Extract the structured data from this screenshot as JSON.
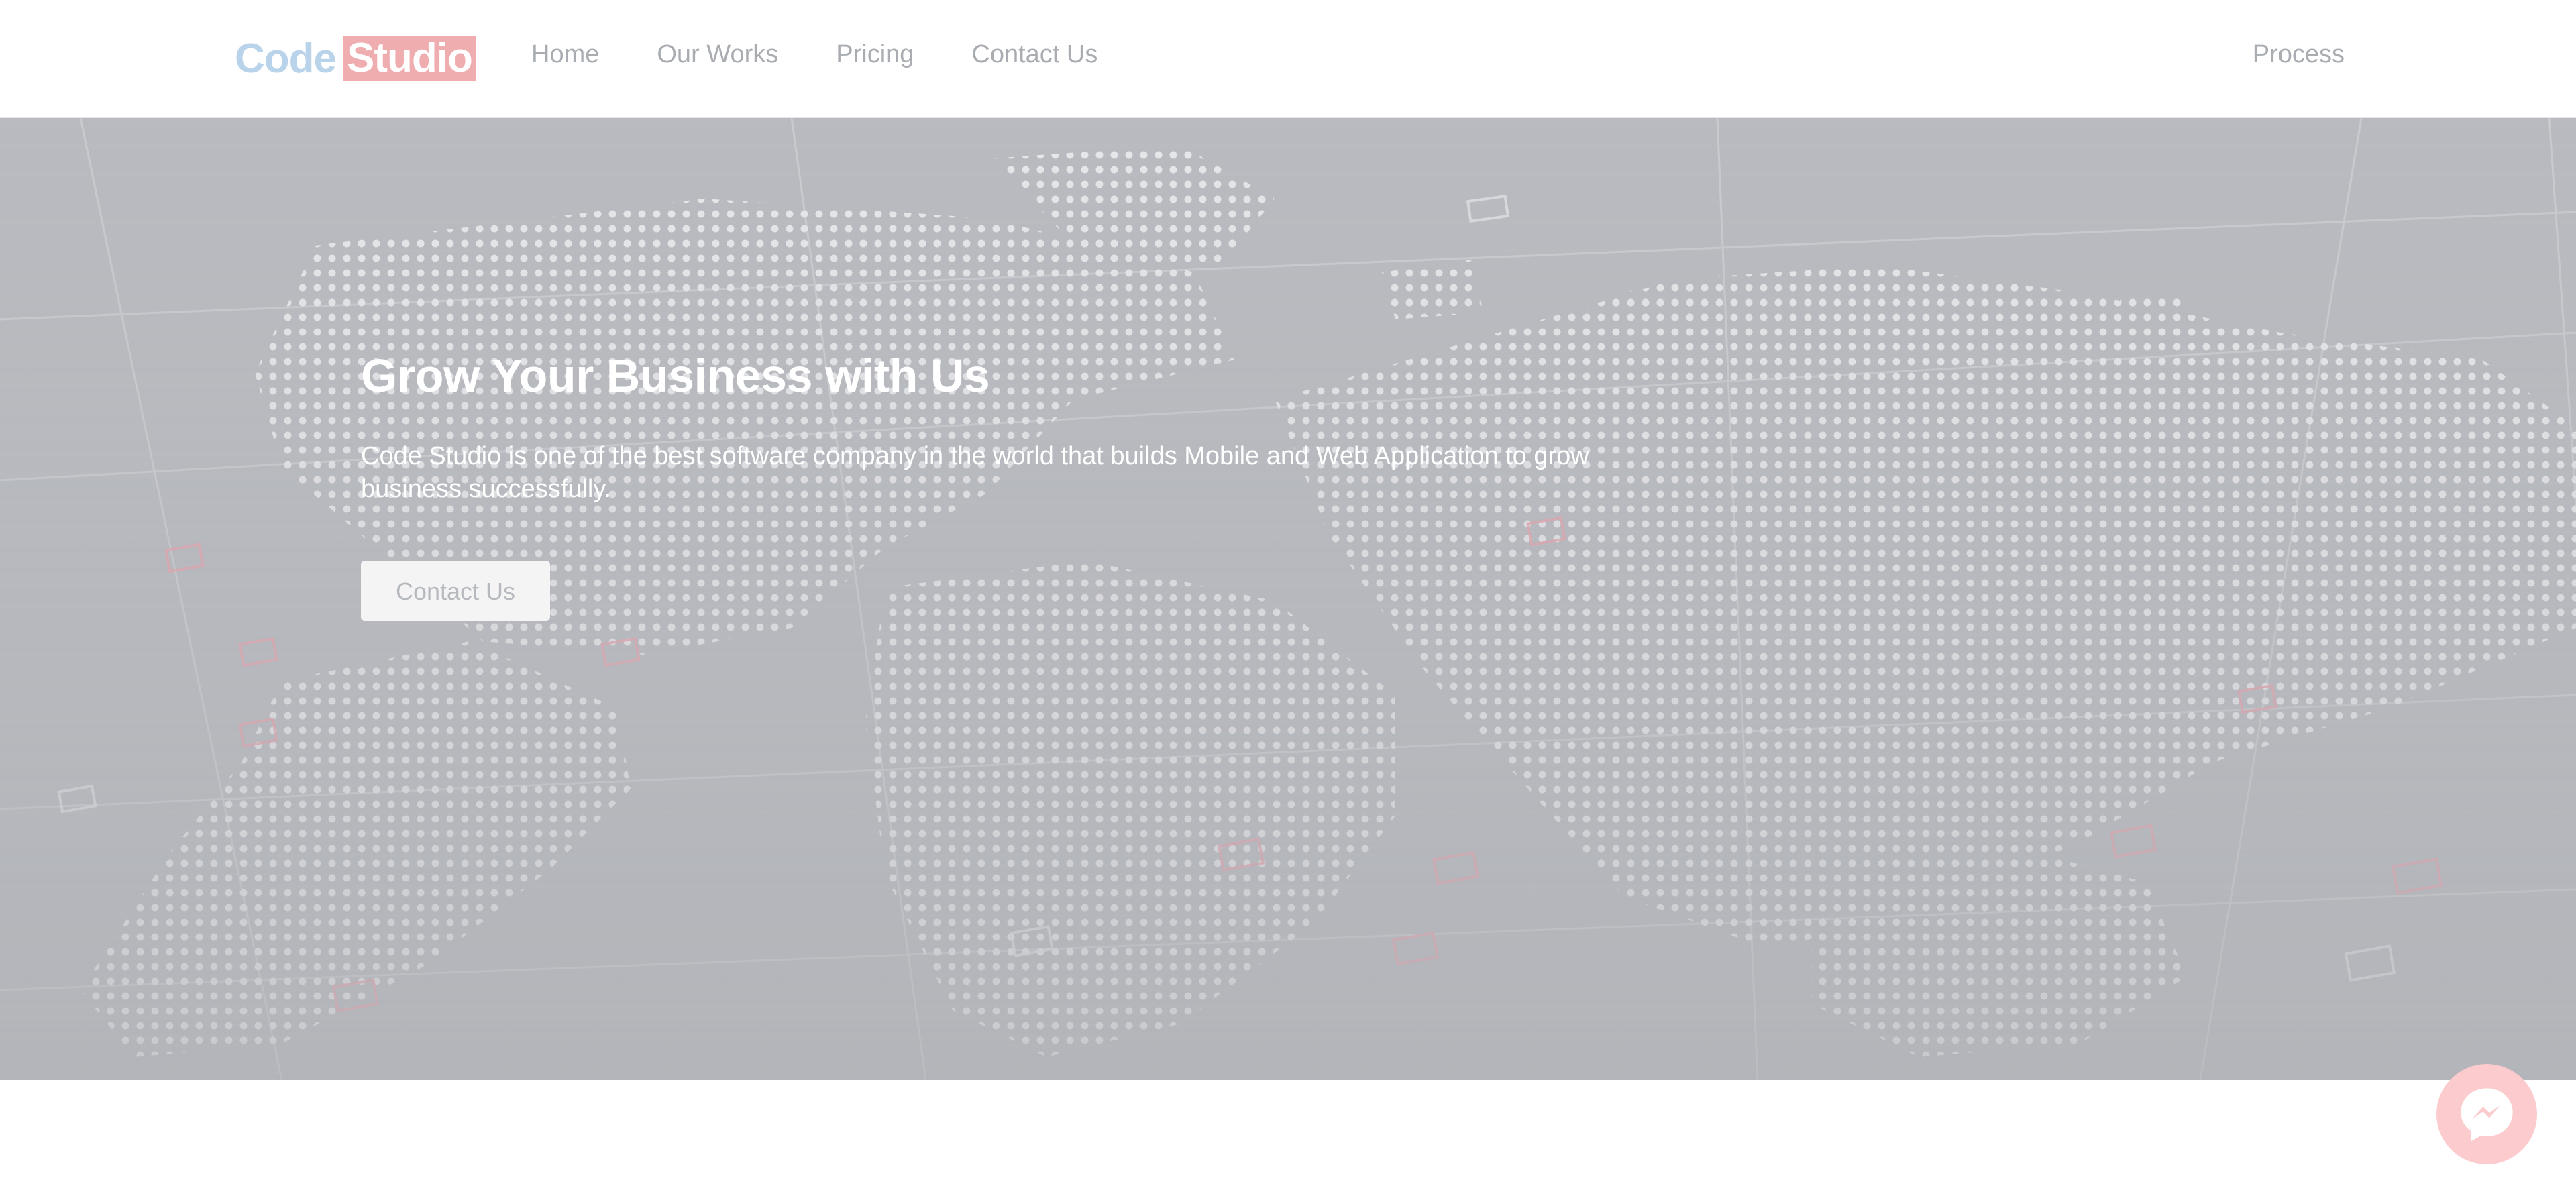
{
  "brand": {
    "part1": "Code",
    "part2": "Studio",
    "colors": {
      "code": "#b9d3ea",
      "studio_bg": "#efadb0"
    }
  },
  "nav": {
    "items": [
      {
        "label": "Home"
      },
      {
        "label": "Our Works"
      },
      {
        "label": "Pricing"
      },
      {
        "label": "Contact Us"
      }
    ],
    "right_label": "Process"
  },
  "hero": {
    "title": "Grow Your Business with Us",
    "description": "Code Studio is one of the best software company in the world that builds Mobile and Web Application to grow business successfully.",
    "button_label": "Contact Us",
    "background_icon": "world-map-dots",
    "colors": {
      "overlay": "#b8babf",
      "accent_squares": "#e7a3ad"
    }
  },
  "messenger": {
    "icon": "messenger-icon",
    "color": "#fbcbcd"
  }
}
